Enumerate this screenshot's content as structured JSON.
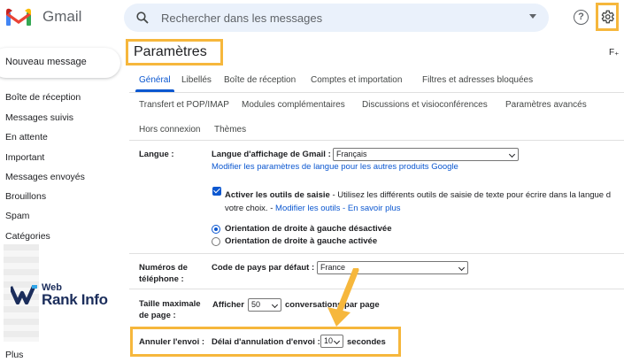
{
  "app": {
    "name": "Gmail"
  },
  "search": {
    "placeholder": "Rechercher dans les messages"
  },
  "header": {
    "help_icon_glyph": "?"
  },
  "compose": {
    "label": "Nouveau message"
  },
  "sidebar": {
    "items": [
      {
        "label": "Boîte de réception"
      },
      {
        "label": "Messages suivis"
      },
      {
        "label": "En attente"
      },
      {
        "label": "Important"
      },
      {
        "label": "Messages envoyés"
      },
      {
        "label": "Brouillons"
      },
      {
        "label": "Spam"
      },
      {
        "label": "Catégories"
      },
      {
        "label": "Plus"
      }
    ]
  },
  "watermark": {
    "line1": "Web",
    "line2": "Rank Info"
  },
  "page": {
    "title": "Paramètres",
    "corner_label": "F₊"
  },
  "tabs": {
    "row1": [
      "Général",
      "Libellés",
      "Boîte de réception",
      "Comptes et importation",
      "Filtres et adresses bloquées"
    ],
    "row2": [
      "Transfert et POP/IMAP",
      "Modules complémentaires",
      "Discussions et visioconférences",
      "Paramètres avancés"
    ],
    "row3": [
      "Hors connexion",
      "Thèmes"
    ],
    "active": "Général"
  },
  "settings": {
    "langue": {
      "label": "Langue :",
      "display_label": "Langue d'affichage de Gmail :",
      "display_value": "Français",
      "other_products_link": "Modifier les paramètres de langue pour les autres produits Google",
      "input_tools_label": "Activer les outils de saisie",
      "input_tools_desc": " - Utilisez les différents outils de saisie de texte pour écrire dans la langue d",
      "input_tools_desc2": "votre choix. - ",
      "edit_tools_link": "Modifier les outils",
      "sep": " - ",
      "learn_more_link": "En savoir plus",
      "rtl_off": "Orientation de droite à gauche désactivée",
      "rtl_on": "Orientation de droite à gauche activée",
      "input_tools_checked": true,
      "rtl_selected": "off"
    },
    "phone": {
      "label_line1": "Numéros de",
      "label_line2": "téléphone :",
      "country_label": "Code de pays par défaut :",
      "country_value": "France"
    },
    "page_size": {
      "label_line1": "Taille maximale",
      "label_line2": "de page :",
      "show_label": "Afficher",
      "show_value": "50",
      "suffix": "conversations par page"
    },
    "undo_send": {
      "label": "Annuler l'envoi :",
      "delay_label": "Délai d'annulation d'envoi :",
      "delay_value": "10",
      "unit": "secondes"
    }
  },
  "colors": {
    "highlight": "#f6b73c",
    "accent": "#0b57d0",
    "gmail_red": "#ea4335",
    "gmail_blue": "#4285f4",
    "gmail_green": "#34a853",
    "gmail_yellow": "#fbbc04"
  },
  "icons": {
    "search": "search-icon",
    "help": "help-icon",
    "settings": "gear-icon",
    "logo": "gmail-logo-icon",
    "watermark": "webrankinfo-logo-icon"
  }
}
